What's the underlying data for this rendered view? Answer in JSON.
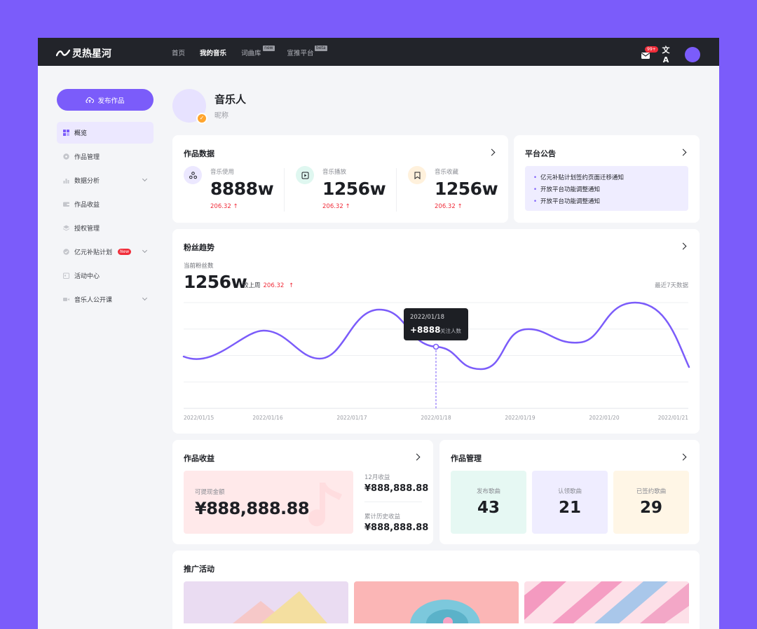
{
  "app": {
    "logo_text": "灵热星河",
    "nav": [
      {
        "label": "首页"
      },
      {
        "label": "我的音乐"
      },
      {
        "label": "词曲库",
        "tag": "new"
      },
      {
        "label": "宣推平台",
        "tag": "beta"
      }
    ],
    "mail_badge": "99+",
    "translate_glyph": "文A"
  },
  "sidebar": {
    "publish_label": "发布作品",
    "items": [
      {
        "label": "概览",
        "icon": "grid-icon"
      },
      {
        "label": "作品管理",
        "icon": "disc-icon"
      },
      {
        "label": "数据分析",
        "icon": "bar-chart-icon"
      },
      {
        "label": "作品收益",
        "icon": "wallet-icon"
      },
      {
        "label": "授权管理",
        "icon": "layers-icon"
      },
      {
        "label": "亿元补贴计划",
        "icon": "check-badge-icon",
        "badge": "New"
      },
      {
        "label": "活动中心",
        "icon": "calendar-icon"
      },
      {
        "label": "音乐人公开课",
        "icon": "video-icon"
      }
    ]
  },
  "profile": {
    "name": "音乐人",
    "nickname": "昵称"
  },
  "works_data": {
    "title": "作品数据",
    "stats": [
      {
        "label": "音乐使用",
        "value": "8888w",
        "change": "206.32"
      },
      {
        "label": "音乐播放",
        "value": "1256w",
        "change": "206.32"
      },
      {
        "label": "音乐收藏",
        "value": "1256w",
        "change": "206.32"
      }
    ]
  },
  "notice": {
    "title": "平台公告",
    "lines": [
      "亿元补贴计划签约页面迁移通知",
      "开放平台功能调整通知",
      "开放平台功能调整通知"
    ]
  },
  "fans": {
    "title": "粉丝趋势",
    "sub_label": "当前粉丝数",
    "value": "1256w",
    "compare_label": "较上周",
    "compare_value": "206.32",
    "range_label": "最近7天数据",
    "tooltip": {
      "date": "2022/01/18",
      "value": "+8888",
      "label": "关注人数"
    }
  },
  "chart_data": {
    "type": "line",
    "x": [
      "2022/01/15",
      "2022/01/16",
      "2022/01/17",
      "2022/01/18",
      "2022/01/19",
      "2022/01/20",
      "2022/01/21"
    ],
    "grid": true,
    "legend": "none",
    "color": "#7b5cfa"
  },
  "income": {
    "title": "作品收益",
    "withdraw_label": "可提现金额",
    "withdraw_value": "¥888,888.88",
    "month_label": "12月收益",
    "month_value": "¥888,888.88",
    "total_label": "累计历史收益",
    "total_value": "¥888,888.88"
  },
  "manage": {
    "title": "作品管理",
    "tiles": [
      {
        "label": "发布歌曲",
        "value": "43",
        "color": "#e6f8f3"
      },
      {
        "label": "认领歌曲",
        "value": "21",
        "color": "#efedff"
      },
      {
        "label": "已签约歌曲",
        "value": "29",
        "color": "#fff6e6"
      }
    ]
  },
  "promo": {
    "title": "推广活动"
  }
}
